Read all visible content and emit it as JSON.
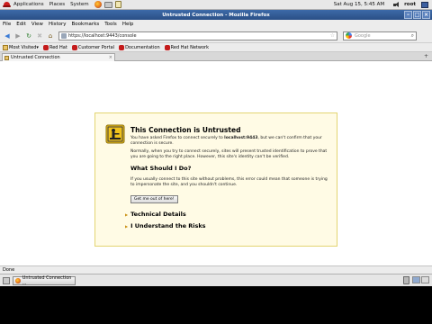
{
  "panel": {
    "menus": [
      "Applications",
      "Places",
      "System"
    ],
    "clock": "Sat Aug 15,  5:45 AM",
    "user": "root"
  },
  "window": {
    "title": "Untrusted Connection - Mozilla Firefox",
    "buttons": [
      "–",
      "□",
      "×"
    ]
  },
  "menubar": [
    "File",
    "Edit",
    "View",
    "History",
    "Bookmarks",
    "Tools",
    "Help"
  ],
  "nav": {
    "url": "https://localhost:9443/console",
    "search_placeholder": "Google"
  },
  "bookmarks": [
    "Most Visited▾",
    "Red Hat",
    "Customer Portal",
    "Documentation",
    "Red Hat Network"
  ],
  "tab": {
    "label": "Untrusted Connection",
    "close": "×",
    "new": "+"
  },
  "error": {
    "title": "This Connection is Untrusted",
    "p1_pre": "You have asked Firefox to connect securely to ",
    "p1_host": "localhost:9443",
    "p1_post": ", but we can't confirm that your connection is secure.",
    "p2": "Normally, when you try to connect securely, sites will present trusted identification to prove that you are going to the right place. However, this site's identity can't be verified.",
    "h2": "What Should I Do?",
    "p3": "If you usually connect to this site without problems, this error could mean that someone is trying to impersonate the site, and you shouldn't continue.",
    "button": "Get me out of here!",
    "technical": "Technical Details",
    "risks": "I Understand the Risks"
  },
  "status": "Done",
  "taskbar": {
    "task": "Untrusted Connection ..."
  },
  "colors": {
    "titlebar": "#3d6aa8",
    "errorbox_border": "#e3d472",
    "errorbox_bg": "#fffbe5"
  }
}
